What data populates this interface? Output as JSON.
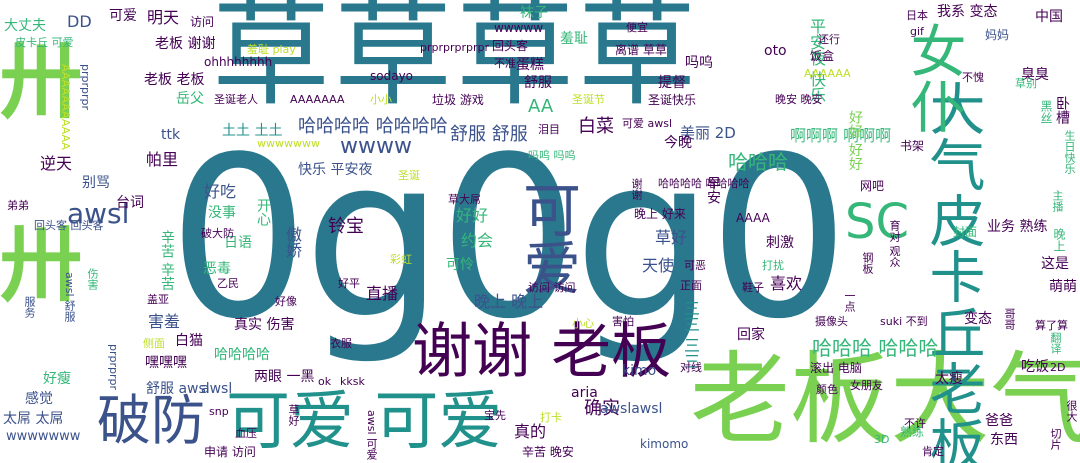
{
  "palette": {
    "teal": "#2a788e",
    "deep_purple": "#440154",
    "indigo": "#3b528b",
    "blue_teal": "#31688e",
    "sea_green": "#21918c",
    "green": "#35b779",
    "lime": "#7ad151",
    "light_lime": "#bddf26"
  },
  "words": [
    "0g0g0",
    "草草草草",
    "老板大气",
    "谢谢 老板",
    "可爱 可爱",
    "破防",
    "大气皮卡丘老板",
    "女仆",
    "可爱",
    "SC",
    "awsl",
    "哈哈哈 哈哈哈",
    "wwww",
    "哈哈哈哈 哈哈哈哈",
    "舒服 舒服",
    "白菜",
    "美丽 2D",
    "今晚",
    "啊啊啊 啊啊啊",
    "平安夜 快乐",
    "好好 好好",
    "铃宝",
    "好好",
    "约会",
    "草好",
    "天使",
    "晚上 晚上",
    "直播",
    "喜欢",
    "回家",
    "哈哈哈",
    "三三 三三",
    "确实",
    "真的",
    "aria",
    "kimo",
    "awslawsl",
    "kimomo",
    "哈哈哈哈",
    "真实 伤害",
    "害羞",
    "白猫",
    "嘿嘿嘿",
    "帕里",
    "逆天",
    "别骂",
    "台词",
    "好吃",
    "没事",
    "开心",
    "日语",
    "辛苦 辛苦",
    "恶毒",
    "傲娇",
    "可怜",
    "快乐 平安夜",
    "ttk",
    "土土 土土",
    "老板 老板",
    "老板 谢谢",
    "岳父",
    "圣诞老人",
    "AAAAAAA",
    "小小",
    "垃圾 游戏",
    "蛋糕",
    "羞耻",
    "舒服",
    "提督",
    "吗呜",
    "AA",
    "wwwww",
    "袜子",
    "DD",
    "可爱",
    "明天",
    "访问",
    "我系 变态",
    "中国",
    "臭臭",
    "大丈夫",
    "皮卡丘 可爱",
    "awsl 舒服",
    "伤害",
    "服务",
    "AAAAAAAAAAA",
    "prprprpr",
    "ohhhhhhhh",
    "prprprprprpr",
    "回头客",
    "sodayo",
    "oto",
    "便宜",
    "羞耻 play",
    "离谱 草草",
    "还行",
    "饭盒",
    "圣诞快乐",
    "晚安 晚安",
    "日本",
    "gif",
    "妈妈",
    "不愧",
    "草别",
    "圣诞节",
    "可爱 awsl",
    "泪目",
    "吗呜 吗呜",
    "圣诞",
    "草大屌",
    "哈哈哈哈 哈哈哈哈",
    "早安",
    "晚上 好来",
    "谢谢",
    "网吧",
    "AAAA",
    "刺激",
    "业务 熟练",
    "封面",
    "晚上",
    "主播",
    "生日快乐",
    "黑丝",
    "卧槽",
    "这是",
    "萌萌",
    "哥哥",
    "算了算",
    "翻译",
    "变态",
    "摄像头",
    "suki 不到",
    "吃饭",
    "太瘦",
    "滚出 电脑",
    "爸爸",
    "东西",
    "女朋友",
    "一点",
    "钢板",
    "育对 观众",
    "可恶",
    "打扰",
    "鞋子",
    "正面",
    "访问 访问",
    "害怕",
    "小心",
    "彩虹",
    "好平",
    "乙民",
    "盖亚",
    "好像",
    "衣服",
    "侧面",
    "舒服 awsl",
    "两眼 一黑",
    "感觉",
    "太屌 太屌",
    "wwwwwww",
    "好瘦",
    "prprprpr",
    "kksk",
    "ok",
    "snp",
    "草好",
    "血压",
    "申请 访问",
    "awsl 可爱",
    "宝先",
    "打卡",
    "辛苦 晚安",
    "颜色",
    "熟练",
    "不许",
    "肯定",
    "3D",
    "很大",
    "切片",
    "2D",
    "对线",
    "破大防",
    "wwwwwww",
    "弟弟",
    "回头客 回头客",
    "书架",
    "不准",
    "AAAAAA",
    "awsl"
  ]
}
